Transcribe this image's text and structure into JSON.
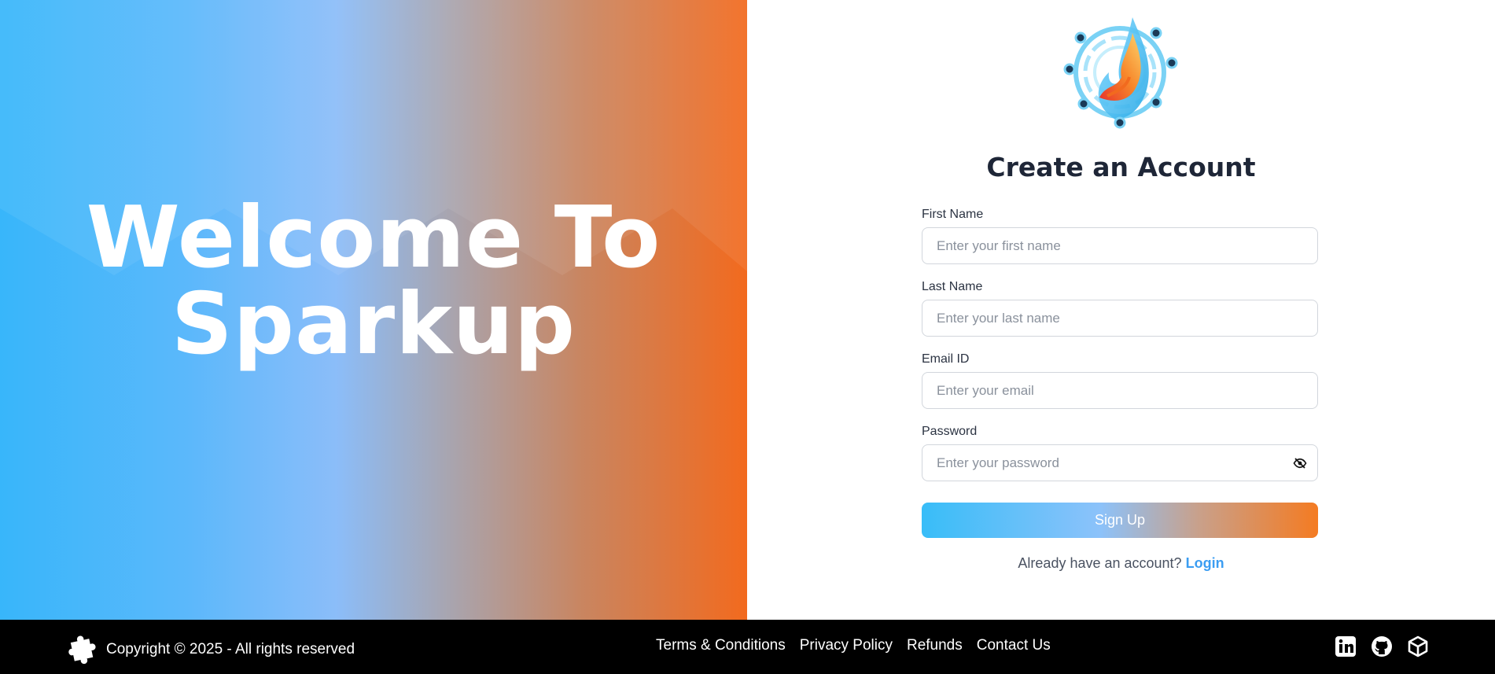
{
  "hero": {
    "line1": "Welcome To",
    "line2": "Sparkup"
  },
  "form": {
    "title": "Create an Account",
    "fields": [
      {
        "label": "First Name",
        "placeholder": "Enter your first name",
        "value": ""
      },
      {
        "label": "Last Name",
        "placeholder": "Enter your last name",
        "value": ""
      },
      {
        "label": "Email ID",
        "placeholder": "Enter your email",
        "value": ""
      },
      {
        "label": "Password",
        "placeholder": "Enter your password",
        "value": ""
      }
    ],
    "password_toggle_icon": "eye-off-icon",
    "submit_label": "Sign Up",
    "login_prompt": "Already have an account?",
    "login_link": "Login"
  },
  "footer": {
    "logo_icon": "puzzle-icon",
    "copyright": "Copyright © 2025 - All rights reserved",
    "links": [
      "Terms & Conditions",
      "Privacy Policy",
      "Refunds",
      "Contact Us"
    ],
    "social_icons": [
      "linkedin-icon",
      "github-icon",
      "cube-icon"
    ]
  },
  "colors": {
    "accent_blue": "#38bdf8",
    "accent_orange": "#f47b22",
    "link": "#3b9df2",
    "footer_bg": "#000000"
  }
}
